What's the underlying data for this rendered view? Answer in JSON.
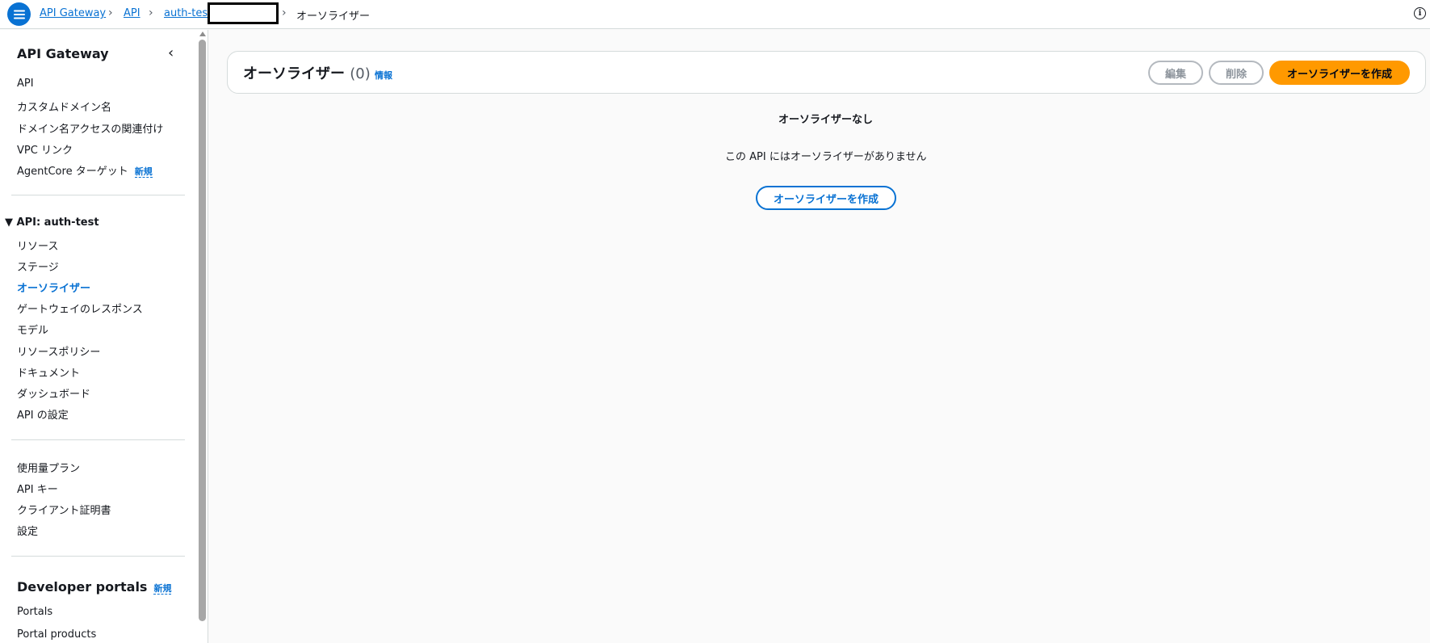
{
  "breadcrumb": {
    "items": [
      "API Gateway",
      "API",
      "auth-test"
    ],
    "current": "オーソライザー"
  },
  "sidebar": {
    "title": "API Gateway",
    "top_items": [
      {
        "label": "API"
      },
      {
        "label": "カスタムドメイン名"
      },
      {
        "label": "ドメイン名アクセスの関連付け"
      },
      {
        "label": "VPC リンク"
      },
      {
        "label": "AgentCore ターゲット",
        "badge": "新規"
      }
    ],
    "api_section": "API: auth-test",
    "api_items": [
      {
        "label": "リソース"
      },
      {
        "label": "ステージ"
      },
      {
        "label": "オーソライザー",
        "active": true
      },
      {
        "label": "ゲートウェイのレスポンス"
      },
      {
        "label": "モデル"
      },
      {
        "label": "リソースポリシー"
      },
      {
        "label": "ドキュメント"
      },
      {
        "label": "ダッシュボード"
      },
      {
        "label": "API の設定"
      }
    ],
    "more_items": [
      {
        "label": "使用量プラン"
      },
      {
        "label": "API キー"
      },
      {
        "label": "クライアント証明書"
      },
      {
        "label": "設定"
      }
    ],
    "portal_section": "Developer portals",
    "portal_badge": "新規",
    "portal_items": [
      {
        "label": "Portals"
      },
      {
        "label": "Portal products"
      }
    ]
  },
  "panel": {
    "title": "オーソライザー",
    "count": "(0)",
    "info": "情報",
    "edit": "編集",
    "delete": "削除",
    "create": "オーソライザーを作成"
  },
  "empty": {
    "title": "オーソライザーなし",
    "description": "この API にはオーソライザーがありません",
    "button": "オーソライザーを作成"
  },
  "colors": {
    "link": "#0972d3",
    "primary": "#ff9900",
    "text": "#16191f"
  }
}
